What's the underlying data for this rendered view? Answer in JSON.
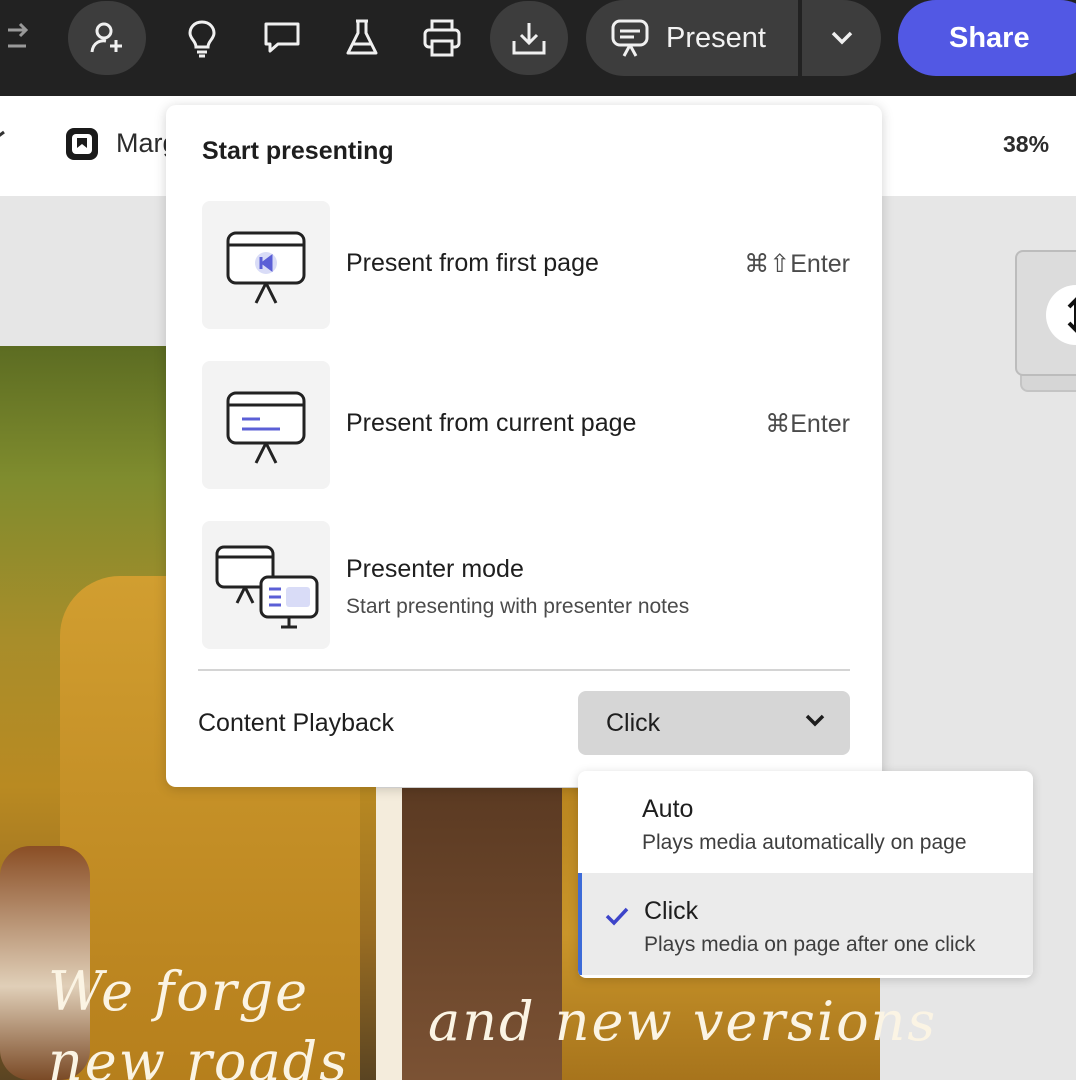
{
  "toolbar": {
    "icons": [
      "arrows-icon",
      "add-user-icon",
      "lightbulb-icon",
      "comment-icon",
      "flask-icon",
      "print-icon",
      "download-icon"
    ],
    "present_label": "Present",
    "share_label": "Share"
  },
  "document": {
    "name": "Marg",
    "zoom": "38%"
  },
  "canvas": {
    "text_left_1": "We forge",
    "text_left_2": "new roads",
    "text_right": "and new versions"
  },
  "present_menu": {
    "title": "Start presenting",
    "options": [
      {
        "label": "Present from first page",
        "shortcut": "⌘⇧Enter",
        "icon": "present-first-page-icon"
      },
      {
        "label": "Present from current page",
        "shortcut": "⌘Enter",
        "icon": "present-current-page-icon"
      },
      {
        "label": "Presenter mode",
        "description": "Start presenting with presenter notes",
        "icon": "presenter-mode-icon"
      }
    ],
    "playback": {
      "label": "Content Playback",
      "value": "Click"
    }
  },
  "playback_dropdown": {
    "items": [
      {
        "label": "Auto",
        "description": "Plays media automatically on page",
        "selected": false
      },
      {
        "label": "Click",
        "description": "Plays media on page after one click",
        "selected": true
      }
    ]
  },
  "colors": {
    "share_button": "#5258e4",
    "toolbar_bg": "#222222",
    "accent_icon": "#5b5fd6",
    "selected_border": "#3d6bd8"
  }
}
